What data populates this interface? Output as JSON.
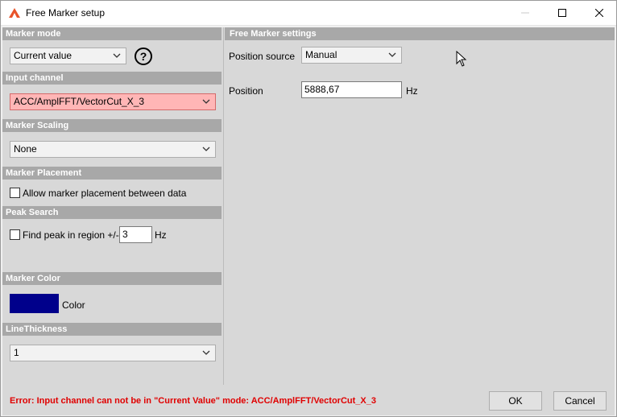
{
  "window": {
    "title": "Free Marker setup",
    "icons": {
      "app": "artemis-logo-icon",
      "minimize": "minimize-icon",
      "maximize": "maximize-icon",
      "close": "close-icon"
    }
  },
  "left": {
    "marker_mode": {
      "header": "Marker mode",
      "value": "Current value",
      "help_icon": "question-circle-icon"
    },
    "input_channel": {
      "header": "Input channel",
      "value": "ACC/AmplFFT/VectorCut_X_3",
      "error_color": "#ffb6b6"
    },
    "marker_scaling": {
      "header": "Marker Scaling",
      "value": "None"
    },
    "marker_placement": {
      "header": "Marker Placement",
      "checkbox_label": "Allow marker placement between data",
      "checked": false
    },
    "peak_search": {
      "header": "Peak Search",
      "checkbox_label": "Find peak in region +/-",
      "checked": false,
      "value": "3",
      "unit": "Hz"
    },
    "marker_color": {
      "header": "Marker Color",
      "label": "Color",
      "swatch": "#00008b"
    },
    "line_thickness": {
      "header": "LineThickness",
      "value": "1"
    }
  },
  "right": {
    "header": "Free Marker settings",
    "position_source": {
      "label": "Position source",
      "value": "Manual"
    },
    "position": {
      "label": "Position",
      "value": "5888,67",
      "unit": "Hz"
    }
  },
  "footer": {
    "error": "Error: Input channel can not be in \"Current Value\" mode: ACC/AmplFFT/VectorCut_X_3",
    "error_color": "#e00000",
    "ok": "OK",
    "cancel": "Cancel"
  }
}
